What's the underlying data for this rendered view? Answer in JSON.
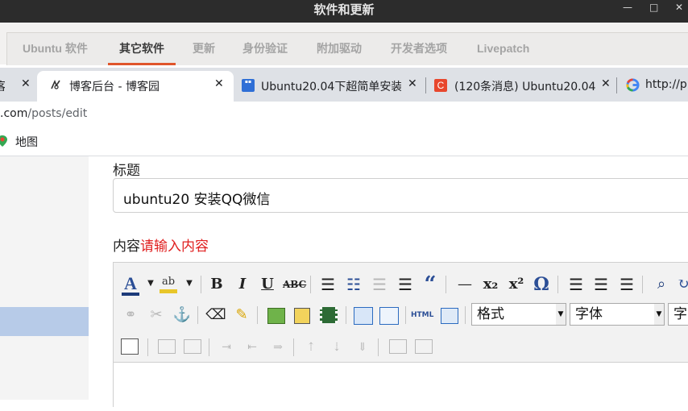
{
  "window": {
    "title": "软件和更新"
  },
  "software_tabs": [
    "Ubuntu 软件",
    "其它软件",
    "更新",
    "身份验证",
    "附加驱动",
    "开发者选项",
    "Livepatch"
  ],
  "software_active_tab": "其它软件",
  "browser_tabs": [
    {
      "label": "客",
      "closable": true
    },
    {
      "label": "博客后台 - 博客园",
      "closable": true,
      "active": true
    },
    {
      "label": "Ubuntu20.04下超简单安装",
      "closable": true
    },
    {
      "label": "(120条消息) Ubuntu20.04",
      "closable": true
    },
    {
      "label": "http://p",
      "closable": false
    }
  ],
  "address": {
    "domain": ".com",
    "path": "/posts/edit"
  },
  "bookmarks": [
    {
      "label": "地图"
    }
  ],
  "form": {
    "title_label": "标题",
    "title_value": "ubuntu20 安装QQ微信",
    "content_label": "内容",
    "content_hint": "请输入内容"
  },
  "editor": {
    "format_combo": "格式",
    "font_combo": "字体",
    "size_combo": "字"
  },
  "colors": {
    "accent": "#e0552b",
    "required": "#e02020",
    "selection": "#b7cbe8"
  }
}
